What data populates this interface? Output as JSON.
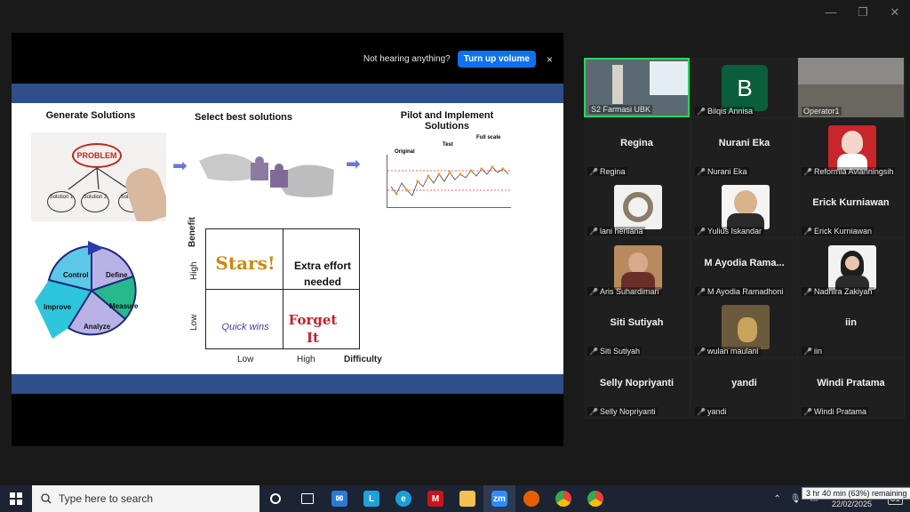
{
  "window": {
    "minimize": "—",
    "maximize": "❐",
    "close": "✕"
  },
  "notice": {
    "text": "Not hearing anything?",
    "button": "Turn up volume",
    "close": "×"
  },
  "slide": {
    "titles": {
      "generate": "Generate Solutions",
      "select": "Select best solutions",
      "pilot": "Pilot and Implement\nSolutions"
    },
    "problem_img": {
      "problem": "PROBLEM",
      "solutions": [
        "Solution 1",
        "Solution 2",
        "Solution 3"
      ]
    },
    "small_chart": {
      "labels": [
        "Original",
        "Test",
        "Full scale"
      ]
    },
    "cycle": [
      "Control",
      "Define",
      "Measure",
      "Analyze",
      "Improve"
    ],
    "matrix": {
      "cells": {
        "tl": "Stars!",
        "tr": "Extra effort needed",
        "bl": "Quick wins",
        "br": "Forget It"
      },
      "y_axis": "Benefit",
      "y_high": "High",
      "y_low": "Low",
      "x_low": "Low",
      "x_high": "High",
      "x_axis": "Difficulty"
    }
  },
  "participants": [
    {
      "name_tile": "",
      "label": "S2 Farmasi UBK",
      "mic": false,
      "kind": "video",
      "active": true
    },
    {
      "name_tile": "B",
      "label": "Bilqis Annisa",
      "mic": true,
      "kind": "avatar"
    },
    {
      "name_tile": "",
      "label": "Operator1",
      "mic": false,
      "kind": "video"
    },
    {
      "name_tile": "Regina",
      "label": "Regina",
      "mic": true,
      "kind": "name"
    },
    {
      "name_tile": "Nurani Eka",
      "label": "Nurani Eka",
      "mic": true,
      "kind": "name"
    },
    {
      "name_tile": "",
      "label": "Reformia Avianningsih",
      "mic": true,
      "kind": "photo"
    },
    {
      "name_tile": "",
      "label": "lani herliana",
      "mic": true,
      "kind": "photo"
    },
    {
      "name_tile": "",
      "label": "Yulius Iskandar",
      "mic": true,
      "kind": "photo"
    },
    {
      "name_tile": "Erick Kurniawan",
      "label": "Erick Kurniawan",
      "mic": true,
      "kind": "name"
    },
    {
      "name_tile": "",
      "label": "Aris Suhardiman",
      "mic": true,
      "kind": "photo"
    },
    {
      "name_tile": "M Ayodia Rama...",
      "label": "M Ayodia Ramadhoni",
      "mic": true,
      "kind": "name"
    },
    {
      "name_tile": "",
      "label": "Nadhira Zakiyah",
      "mic": true,
      "kind": "photo"
    },
    {
      "name_tile": "Siti Sutiyah",
      "label": "Siti Sutiyah",
      "mic": true,
      "kind": "name"
    },
    {
      "name_tile": "",
      "label": "wulan maulani",
      "mic": true,
      "kind": "photo"
    },
    {
      "name_tile": "iin",
      "label": "iin",
      "mic": true,
      "kind": "name"
    },
    {
      "name_tile": "Selly Nopriyanti",
      "label": "Selly Nopriyanti",
      "mic": true,
      "kind": "name"
    },
    {
      "name_tile": "yandi",
      "label": "yandi",
      "mic": true,
      "kind": "name"
    },
    {
      "name_tile": "Windi Pratama",
      "label": "Windi Pratama",
      "mic": true,
      "kind": "name"
    }
  ],
  "taskbar": {
    "search_placeholder": "Type here to search",
    "icons": [
      "cortana-icon",
      "task-view-icon",
      "mail-icon",
      "l-app-icon",
      "edge-icon",
      "mcafee-icon",
      "file-explorer-icon",
      "zoom-icon",
      "firefox-icon",
      "chrome-icon",
      "chrome-profile-icon"
    ],
    "battery_tooltip": "3 hr 40 min (63%) remaining",
    "date": "22/02/2025",
    "notifications": "31"
  },
  "colors": {
    "zoom_blue": "#0e72ed",
    "slide_band": "#2e4f8c",
    "active_speaker": "#23d959"
  }
}
